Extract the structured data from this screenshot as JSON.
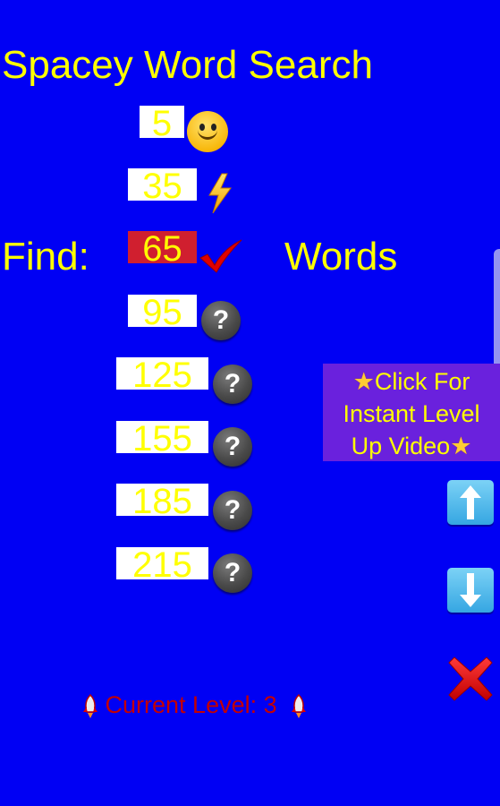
{
  "app": {
    "title": "Spacey Word Search"
  },
  "find_row": {
    "prefix": "Find:",
    "suffix": "Words"
  },
  "levels": [
    {
      "value": "5",
      "status": "completed",
      "icon": "smiley-face-icon"
    },
    {
      "value": "35",
      "status": "completed",
      "icon": "lightning-bolt-icon"
    },
    {
      "value": "65",
      "status": "selected",
      "icon": "checkmark-icon"
    },
    {
      "value": "95",
      "status": "locked",
      "icon": "question-mark-icon"
    },
    {
      "value": "125",
      "status": "locked",
      "icon": "question-mark-icon"
    },
    {
      "value": "155",
      "status": "locked",
      "icon": "question-mark-icon"
    },
    {
      "value": "185",
      "status": "locked",
      "icon": "question-mark-icon"
    },
    {
      "value": "215",
      "status": "locked",
      "icon": "question-mark-icon"
    }
  ],
  "question_glyph": "?",
  "ad": {
    "line1": "Click For",
    "line2": "Instant Level",
    "line3": "Up Video",
    "icon": "star-icon"
  },
  "controls": {
    "up": "arrow-up-icon",
    "down": "arrow-down-icon",
    "close": "close-x-icon"
  },
  "status": {
    "label": "Current Level: 3",
    "icon": "rocket-icon"
  },
  "colors": {
    "background": "#0000f4",
    "text_primary": "#ffff00",
    "selected_box": "#d01f2f",
    "ad_bg": "#6a21dd",
    "status_text": "#c40000"
  }
}
